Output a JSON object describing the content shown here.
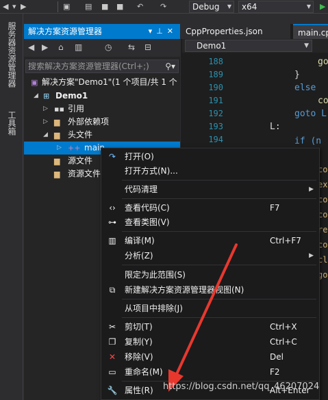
{
  "toolbar": {
    "config": "Debug",
    "platform": "x64"
  },
  "sidebar": {
    "tab1": "服务器资源管理器",
    "tab2": "工具箱"
  },
  "solution_explorer": {
    "title": "解决方案资源管理器",
    "search_placeholder": "搜索解决方案资源管理器(Ctrl+;)",
    "solution": "解决方案\"Demo1\"(1 个项目/共 1 个",
    "project": "Demo1",
    "references": "引用",
    "external_deps": "外部依赖项",
    "header_files": "头文件",
    "main_file": "main",
    "source_files": "源文件",
    "resource_files": "资源文件"
  },
  "editor": {
    "tabs": [
      "CppProperties.json",
      "main.cpp"
    ],
    "nav_scope": "Demo1",
    "lines": [
      "188",
      "189",
      "190",
      "191",
      "192",
      "193",
      "194"
    ],
    "code": [
      "go",
      "}",
      "else",
      "co",
      "goto L",
      "L:",
      "if (n"
    ],
    "right_fragments": [
      "co",
      "ex",
      "co",
      "co",
      "re",
      "co",
      "cl",
      "go"
    ]
  },
  "context_menu": {
    "items": [
      {
        "label": "打开(O)",
        "shortcut": "",
        "icon": "open-icon"
      },
      {
        "label": "打开方式(N)...",
        "shortcut": "",
        "icon": ""
      },
      {
        "label": "代码清理",
        "shortcut": "",
        "icon": ""
      },
      {
        "label": "查看代码(C)",
        "shortcut": "F7",
        "icon": "code-icon"
      },
      {
        "label": "查看类图(V)",
        "shortcut": "",
        "icon": "class-diagram-icon"
      },
      {
        "label": "编译(M)",
        "shortcut": "Ctrl+F7",
        "icon": "compile-icon"
      },
      {
        "label": "分析(Z)",
        "shortcut": "",
        "icon": ""
      },
      {
        "label": "限定为此范围(S)",
        "shortcut": "",
        "icon": ""
      },
      {
        "label": "新建解决方案资源管理器视图(N)",
        "shortcut": "",
        "icon": "new-view-icon"
      },
      {
        "label": "从项目中排除(J)",
        "shortcut": "",
        "icon": ""
      },
      {
        "label": "剪切(T)",
        "shortcut": "Ctrl+X",
        "icon": "cut-icon"
      },
      {
        "label": "复制(Y)",
        "shortcut": "Ctrl+C",
        "icon": "copy-icon"
      },
      {
        "label": "移除(V)",
        "shortcut": "Del",
        "icon": "remove-icon"
      },
      {
        "label": "重命名(M)",
        "shortcut": "F2",
        "icon": "rename-icon"
      },
      {
        "label": "属性(R)",
        "shortcut": "Alt+Enter",
        "icon": "wrench-icon"
      }
    ]
  },
  "colors": {
    "accent": "#007acc",
    "background": "#2d2d30",
    "menu": "#1b1b1c",
    "annotation_arrow": "#e8382e"
  },
  "watermark": "https://blog.csdn.net/qq_46207024"
}
